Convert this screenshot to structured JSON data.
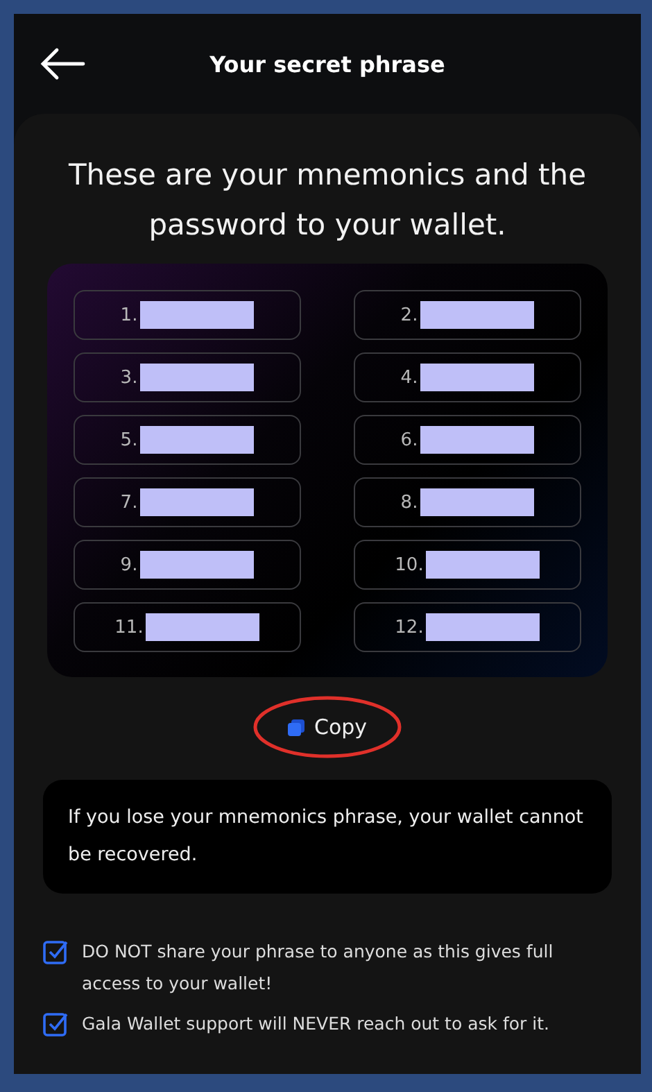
{
  "header": {
    "title": "Your secret phrase"
  },
  "heading": "These are your mnemonics and the password to your wallet.",
  "words": [
    {
      "number": "1.",
      "redacted": true
    },
    {
      "number": "2.",
      "redacted": true
    },
    {
      "number": "3.",
      "redacted": true
    },
    {
      "number": "4.",
      "redacted": true
    },
    {
      "number": "5.",
      "redacted": true
    },
    {
      "number": "6.",
      "redacted": true
    },
    {
      "number": "7.",
      "redacted": true
    },
    {
      "number": "8.",
      "redacted": true
    },
    {
      "number": "9.",
      "redacted": true
    },
    {
      "number": "10.",
      "redacted": true
    },
    {
      "number": "11.",
      "redacted": true
    },
    {
      "number": "12.",
      "redacted": true
    }
  ],
  "copy_button": {
    "label": "Copy",
    "circled": true
  },
  "warning": "If you lose your mnemonics phrase, your wallet cannot be recovered.",
  "checklist": [
    {
      "text": "DO NOT share your phrase to anyone as this gives full access to your wallet!",
      "checked": true
    },
    {
      "text": "Gala Wallet support will NEVER reach out to ask for it.",
      "checked": true
    }
  ]
}
